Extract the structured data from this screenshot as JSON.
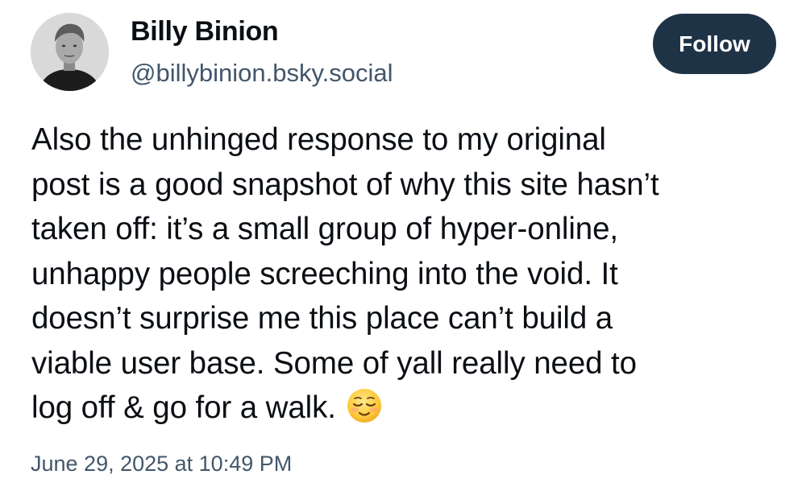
{
  "author": {
    "name": "Billy Binion",
    "handle": "@billybinion.bsky.social",
    "avatar_icon": "profile-photo"
  },
  "follow_button": {
    "label": "Follow",
    "color": "#1f3347"
  },
  "post": {
    "lines": [
      "Also the unhinged response to my original",
      "post is a good snapshot of why this site hasn’t",
      "taken off: it’s a small group of hyper-online,",
      "unhappy people screeching into the void. It",
      "doesn’t surprise me this place can’t build a",
      "viable user base. Some of yall really need to",
      "log off & go for a walk."
    ],
    "emoji_icon": "relieved-face-emoji"
  },
  "timestamp": "June 29, 2025 at 10:49 PM",
  "colors": {
    "text": "#0b0f14",
    "secondary": "#42566b",
    "background": "#ffffff"
  }
}
